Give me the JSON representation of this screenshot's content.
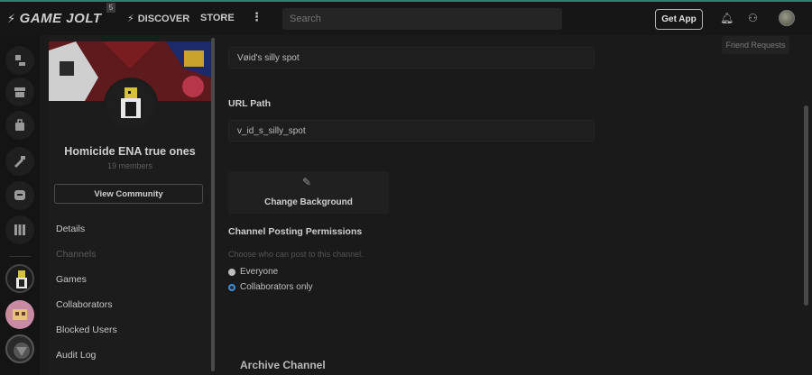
{
  "header": {
    "logo": "GAME JOLT",
    "badge": "5",
    "nav": {
      "discover": "DISCOVER",
      "store": "STORE",
      "more": "⋮"
    },
    "search_placeholder": "Search",
    "get_app": "Get App",
    "tooltip": "Friend Requests"
  },
  "sidebar": {
    "community_name": "Homicide ENA true ones",
    "members": "19 members",
    "view_button": "View Community",
    "menu": [
      {
        "label": "Details"
      },
      {
        "label": "Channels"
      },
      {
        "label": "Games"
      },
      {
        "label": "Collaborators"
      },
      {
        "label": "Blocked Users"
      },
      {
        "label": "Audit Log"
      }
    ]
  },
  "main": {
    "channel_title_value": "Vøid's silly spot",
    "url_path_label": "URL Path",
    "url_path_value": "v_id_s_silly_spot",
    "change_background": "Change Background",
    "permissions_label": "Channel Posting Permissions",
    "permissions_hint": "Choose who can post to this channel.",
    "options": [
      {
        "label": "Everyone",
        "selected": false
      },
      {
        "label": "Collaborators only",
        "selected": true
      }
    ],
    "archive_label": "Archive Channel"
  },
  "colors": {
    "accent": "#3d8fd6",
    "topbar_border": "#2f7f6f",
    "background": "#1a1a1a"
  }
}
